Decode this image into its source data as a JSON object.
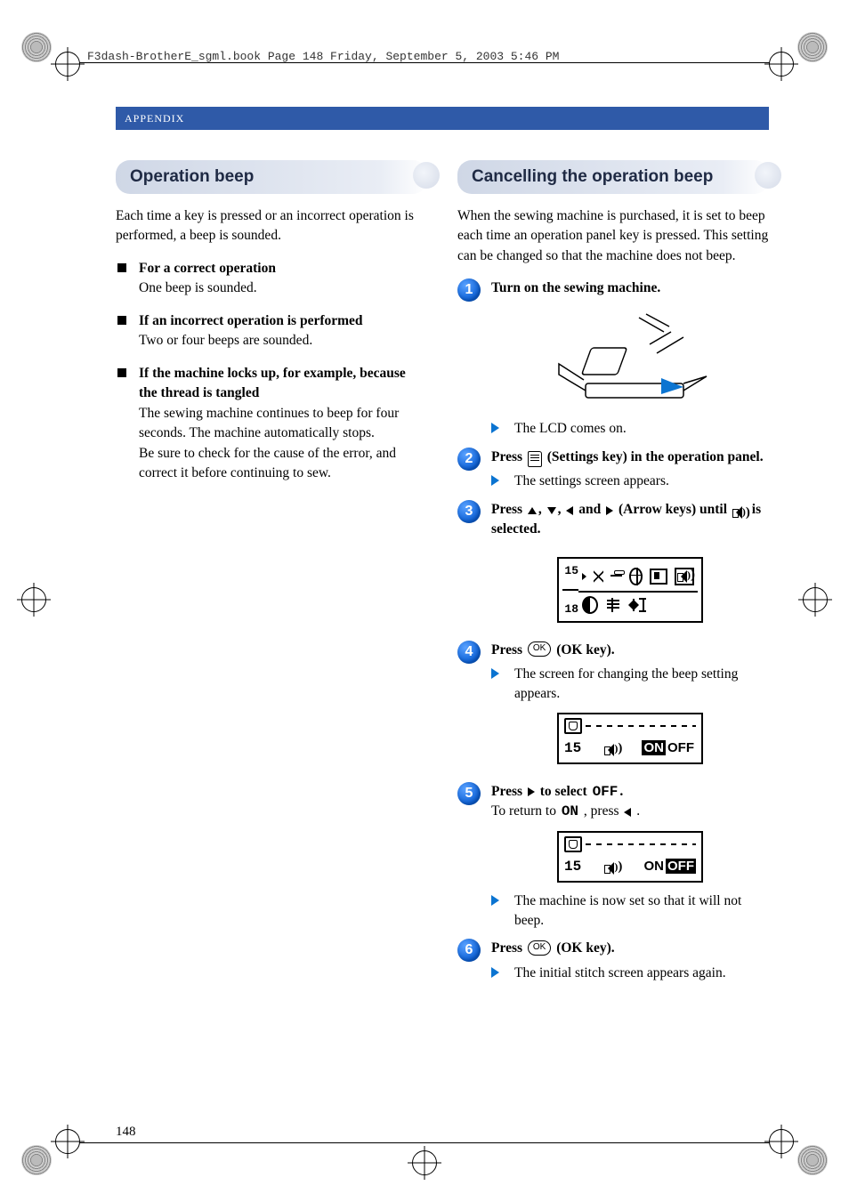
{
  "running_header": "F3dash-BrotherE_sgml.book  Page 148  Friday, September 5, 2003  5:46 PM",
  "appendix_label": "APPENDIX",
  "page_number": "148",
  "left": {
    "heading": "Operation beep",
    "intro": "Each time a key is pressed or an incorrect operation is performed, a beep is sounded.",
    "items": [
      {
        "title": "For a correct operation",
        "body": "One beep is sounded."
      },
      {
        "title": "If an incorrect operation is performed",
        "body": "Two or four beeps are sounded."
      },
      {
        "title": "If the machine locks up, for example, because the thread is tangled",
        "body": "The sewing machine continues to beep for four seconds. The machine automatically stops.",
        "body2": "Be sure to check for the cause of the error, and correct it before continuing to sew."
      }
    ]
  },
  "right": {
    "heading": "Cancelling the operation beep",
    "intro": "When the sewing machine is purchased, it is set to beep each time an operation panel key is pressed. This setting can be changed so that the machine does not beep.",
    "steps": {
      "s1": {
        "num": "1",
        "head": "Turn on the sewing machine.",
        "result": "The LCD comes on."
      },
      "s2": {
        "num": "2",
        "head_a": "Press ",
        "head_b": " (Settings key) in the operation panel.",
        "result": "The settings screen appears."
      },
      "s3": {
        "num": "3",
        "head_a": "Press ",
        "comma": ", ",
        "and": " and ",
        "head_b": " (Arrow keys) until ",
        "head_c": " is selected."
      },
      "s4": {
        "num": "4",
        "head_a": "Press ",
        "head_b": " (OK key).",
        "result": "The screen for changing the beep setting appears."
      },
      "s5": {
        "num": "5",
        "head_a": "Press ",
        "head_b": " to select ",
        "off": "OFF",
        "head_c": ".",
        "sub_a": "To return to ",
        "on": "ON",
        "sub_b": ", press ",
        "sub_c": ".",
        "result": "The machine is now set so that it will not beep."
      },
      "s6": {
        "num": "6",
        "head_a": "Press ",
        "head_b": " (OK key).",
        "result": "The initial stitch screen appears again."
      }
    },
    "lcd": {
      "settings_left_top": "15",
      "settings_left_bot": "18",
      "beep_num": "15",
      "on": "ON",
      "off": "OFF"
    }
  }
}
